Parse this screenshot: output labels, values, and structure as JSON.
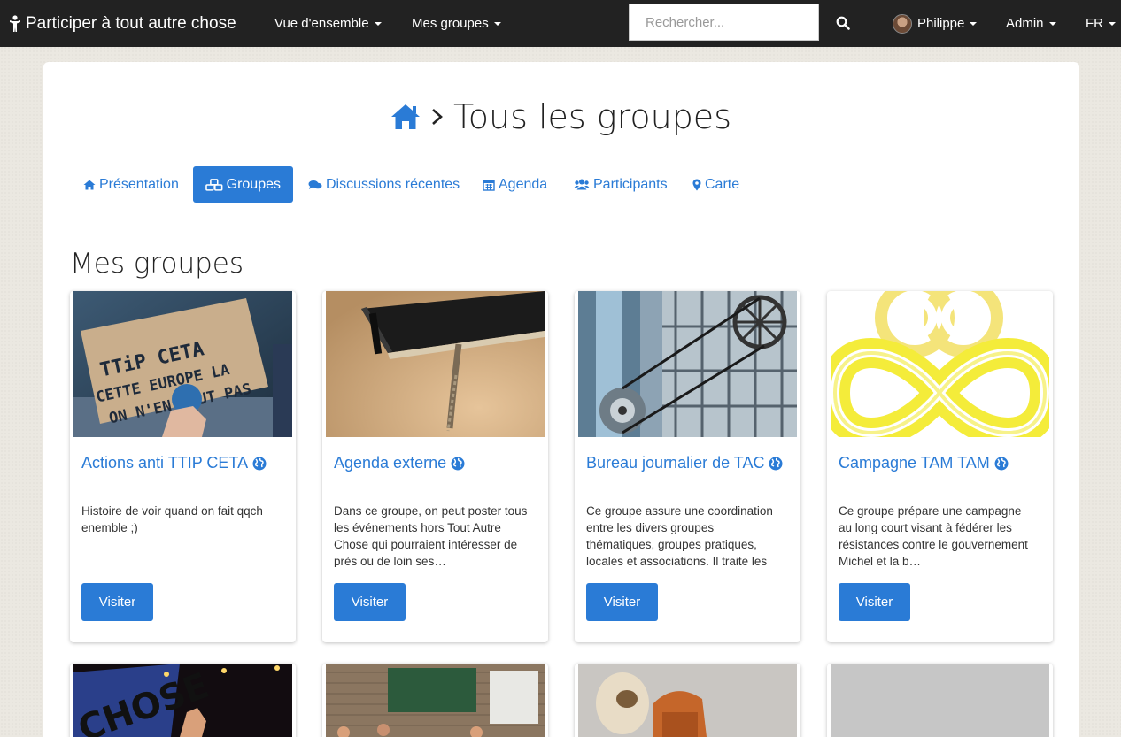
{
  "navbar": {
    "brand": "Participer à tout autre chose",
    "overview": "Vue d'ensemble",
    "my_groups": "Mes groupes",
    "search_placeholder": "Rechercher...",
    "user": "Philippe",
    "admin": "Admin",
    "lang": "FR"
  },
  "page": {
    "title": "Tous les groupes",
    "separator": "›"
  },
  "tabs": [
    {
      "label": "Présentation",
      "icon": "home-icon"
    },
    {
      "label": "Groupes",
      "icon": "cubes-icon",
      "active": true
    },
    {
      "label": "Discussions récentes",
      "icon": "comments-icon"
    },
    {
      "label": "Agenda",
      "icon": "calendar-icon"
    },
    {
      "label": "Participants",
      "icon": "users-icon"
    },
    {
      "label": "Carte",
      "icon": "map-marker-icon"
    }
  ],
  "section": {
    "title": "Mes groupes"
  },
  "groups": [
    {
      "title": "Actions anti TTIP CETA",
      "description": "Histoire de voir quand on fait qqch enemble ;)",
      "button": "Visiter",
      "image_text": "TTIP CETA CETTE EUROPE LA ON N'EN VEUT PAS"
    },
    {
      "title": "Agenda externe",
      "description": "Dans ce groupe, on peut poster tous les événements hors Tout Autre Chose qui pourraient intéresser de près ou de loin ses…",
      "button": "Visiter"
    },
    {
      "title": "Bureau journalier de TAC",
      "description": "Ce groupe assure une coordination entre les divers groupes thématiques, groupes pratiques, locales et associations. Il traite les demandes",
      "button": "Visiter"
    },
    {
      "title": "Campagne TAM TAM",
      "description": "Ce groupe prépare une campagne au long court visant à fédérer les résistances contre le gouvernement Michel et la b…",
      "button": "Visiter"
    }
  ],
  "colors": {
    "accent": "#2a7bd6",
    "navbar": "#222222",
    "background": "#ebe8e1"
  }
}
